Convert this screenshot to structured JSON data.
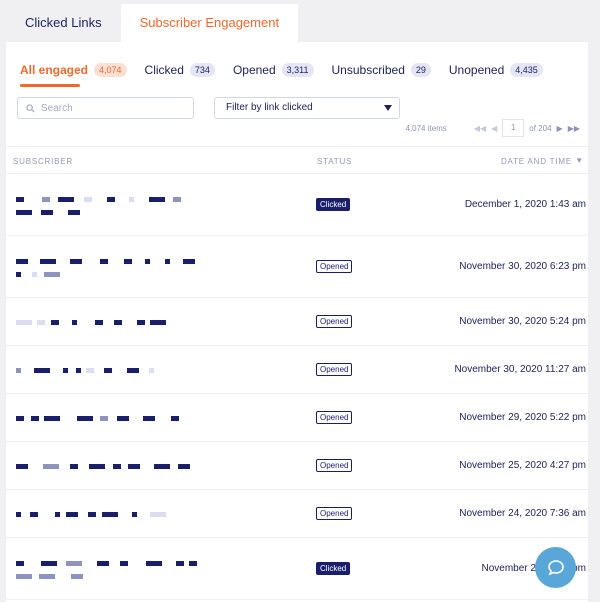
{
  "tabs": [
    {
      "label": "Clicked Links",
      "active": false
    },
    {
      "label": "Subscriber Engagement",
      "active": true
    }
  ],
  "filters": [
    {
      "label": "All engaged",
      "count": "4,074",
      "active": true
    },
    {
      "label": "Clicked",
      "count": "734"
    },
    {
      "label": "Opened",
      "count": "3,311"
    },
    {
      "label": "Unsubscribed",
      "count": "29"
    },
    {
      "label": "Unopened",
      "count": "4,435"
    }
  ],
  "search": {
    "placeholder": "Search",
    "icon": "search-icon"
  },
  "link_filter": {
    "value": "Filter by link clicked"
  },
  "pager": {
    "items": "4,074 items",
    "page": "1",
    "of": "of 204"
  },
  "table": {
    "headers": {
      "subscriber": "SUBSCRIBER",
      "status": "STATUS",
      "date": "DATE AND TIME"
    },
    "rows": [
      {
        "status": "Clicked",
        "date": "December 1, 2020 1:43 am"
      },
      {
        "status": "Opened",
        "date": "November 30, 2020 6:23 pm"
      },
      {
        "status": "Opened",
        "date": "November 30, 2020 5:24 pm"
      },
      {
        "status": "Opened",
        "date": "November 30, 2020 11:27 am"
      },
      {
        "status": "Opened",
        "date": "November 29, 2020 5:22 pm"
      },
      {
        "status": "Opened",
        "date": "November 25, 2020 4:27 pm"
      },
      {
        "status": "Opened",
        "date": "November 24, 2020 7:36 am"
      },
      {
        "status": "Clicked",
        "date": "November 23, 2020 pm"
      }
    ]
  },
  "colors": {
    "accent": "#ef6a2e",
    "navy": "#1a1f6b",
    "chat": "#59a7d8"
  }
}
